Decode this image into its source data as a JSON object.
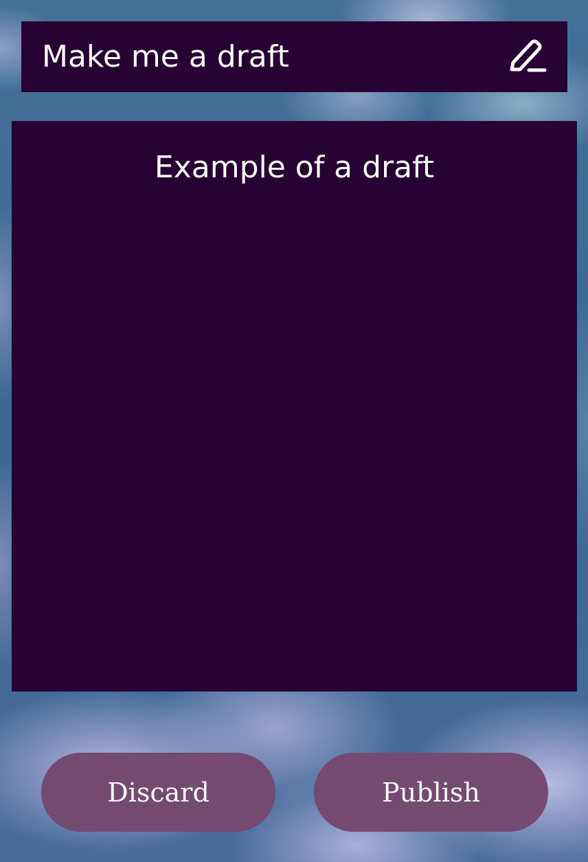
{
  "header": {
    "title": "Make me a draft",
    "edit_icon": "pencil-icon"
  },
  "draft": {
    "title": "Example of a draft"
  },
  "actions": {
    "discard_label": "Discard",
    "publish_label": "Publish"
  },
  "colors": {
    "panel": "#290234",
    "button": "#744a72",
    "text": "#ffffff",
    "background": "#3e6a95"
  }
}
